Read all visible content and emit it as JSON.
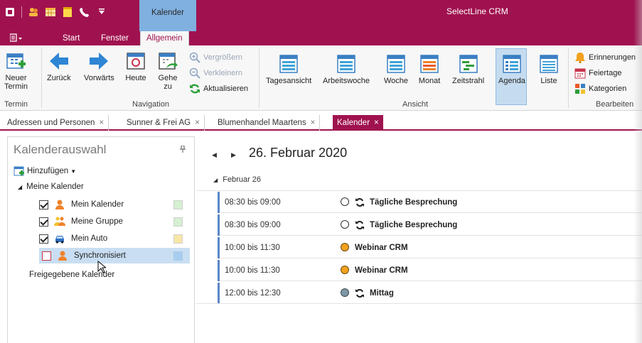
{
  "window": {
    "app_title": "SelectLine CRM",
    "context_tab": "Kalender"
  },
  "ribbon_tabs": [
    "Start",
    "Fenster",
    "Allgemein"
  ],
  "ribbon": {
    "termin_group": {
      "label": "Termin",
      "new_line1": "Neuer",
      "new_line2": "Termin"
    },
    "navigation_group": {
      "label": "Navigation",
      "back": "Zurück",
      "forward": "Vorwärts",
      "today": "Heute",
      "goto_line1": "Gehe",
      "goto_line2": "zu",
      "zoom_in": "Vergrößern",
      "zoom_out": "Verkleinern",
      "refresh": "Aktualisieren"
    },
    "view_group": {
      "label": "Ansicht",
      "views": [
        "Tagesansicht",
        "Arbeitswoche",
        "Woche",
        "Monat",
        "Zeitstrahl",
        "Agenda",
        "Liste"
      ],
      "active": "Agenda"
    },
    "edit_group": {
      "label": "Bearbeiten",
      "reminders": "Erinnerungen",
      "holidays": "Feiertage",
      "categories": "Kategorien"
    }
  },
  "doc_tabs": [
    {
      "label": "Adressen und Personen",
      "close": "×"
    },
    {
      "label": "Sunner & Frei AG",
      "close": "×"
    },
    {
      "label": "Blumenhandel  Maartens",
      "close": "×"
    },
    {
      "label": "Kalender",
      "close": "×",
      "active": true
    }
  ],
  "calendar_panel": {
    "title": "Kalenderauswahl",
    "add_label": "Hinzufügen",
    "root_label": "Meine Kalender",
    "calendars": [
      {
        "name": "Mein Kalender",
        "checked": true,
        "color": "#d4f0d0"
      },
      {
        "name": "Meine Gruppe",
        "checked": true,
        "color": "#d4f0d0"
      },
      {
        "name": "Mein Auto",
        "checked": true,
        "color": "#f8e6a6"
      },
      {
        "name": "Synchronisiert",
        "checked": false,
        "color": "#a9cdee"
      }
    ],
    "shared_label": "Freigegebene Kalender"
  },
  "agenda": {
    "date_title": "26. Februar 2020",
    "day_header": "Februar 26",
    "entries": [
      {
        "time": "08:30 bis 09:00",
        "subject": "Tägliche Besprechung",
        "recurring": true,
        "status": "free"
      },
      {
        "time": "08:30 bis 09:00",
        "subject": "Tägliche Besprechung",
        "recurring": true,
        "status": "free"
      },
      {
        "time": "10:00 bis 11:30",
        "subject": "Webinar CRM",
        "recurring": false,
        "status": "tentative"
      },
      {
        "time": "10:00 bis 11:30",
        "subject": "Webinar CRM",
        "recurring": false,
        "status": "tentative"
      },
      {
        "time": "12:00 bis 12:30",
        "subject": "Mittag",
        "recurring": true,
        "status": "oof"
      }
    ]
  },
  "colors": {
    "brand": "#a0124f",
    "accent_blue": "#5b87c9",
    "status_tentative": "#f2a11e",
    "status_oof": "#7f97a6"
  }
}
